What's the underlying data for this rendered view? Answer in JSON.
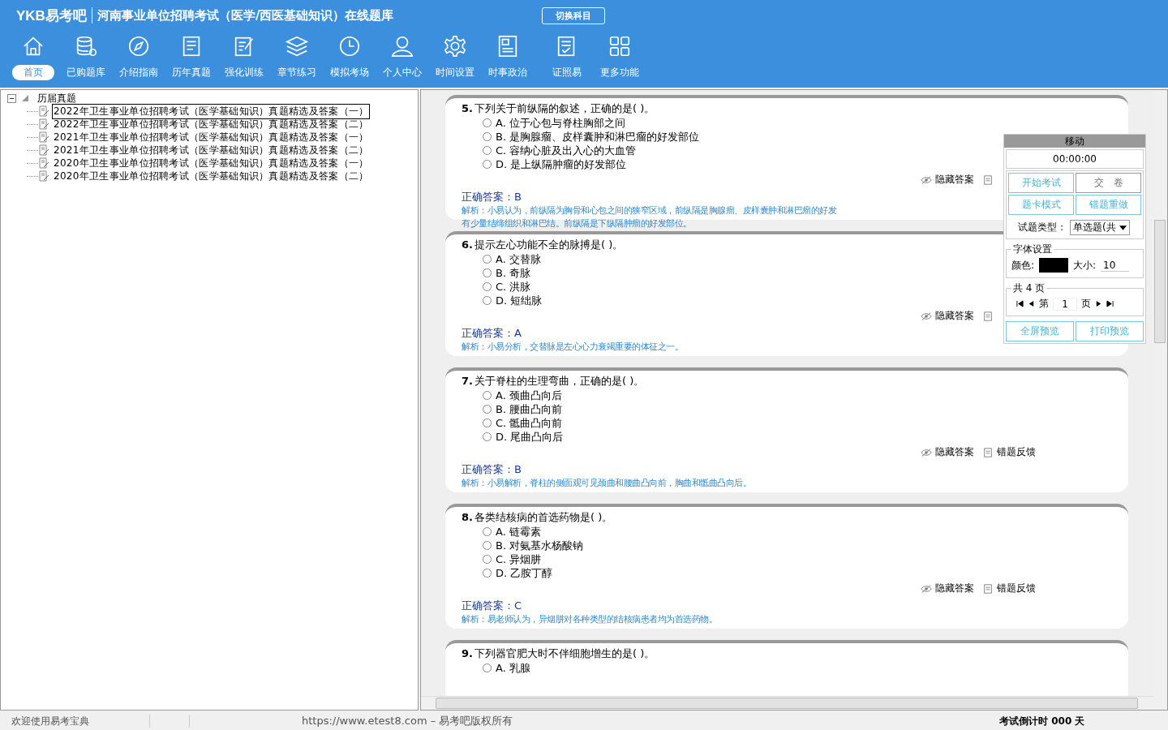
{
  "header": {
    "logo": "YKB易考吧",
    "title": "河南事业单位招聘考试（医学/西医基础知识）在线题库",
    "switch_button": "切换科目"
  },
  "nav": [
    {
      "label": "首页",
      "selected": true
    },
    {
      "label": "已购题库",
      "selected": false
    },
    {
      "label": "介绍指南",
      "selected": false
    },
    {
      "label": "历年真题",
      "selected": false
    },
    {
      "label": "强化训练",
      "selected": false
    },
    {
      "label": "章节练习",
      "selected": false
    },
    {
      "label": "模拟考场",
      "selected": false
    },
    {
      "label": "个人中心",
      "selected": false
    },
    {
      "label": "时间设置",
      "selected": false
    },
    {
      "label": "时事政治",
      "selected": false
    },
    {
      "label": "证照易",
      "selected": false
    },
    {
      "label": "更多功能",
      "selected": false
    }
  ],
  "tree": {
    "label": "历届真题",
    "expanded": true,
    "children": [
      {
        "label": "2022年卫生事业单位招聘考试（医学基础知识）真题精选及答案（一）",
        "selected": true
      },
      {
        "label": "2022年卫生事业单位招聘考试（医学基础知识）真题精选及答案（二）",
        "selected": false
      },
      {
        "label": "2021年卫生事业单位招聘考试（医学基础知识）真题精选及答案（一）",
        "selected": false
      },
      {
        "label": "2021年卫生事业单位招聘考试（医学基础知识）真题精选及答案（二）",
        "selected": false
      },
      {
        "label": "2020年卫生事业单位招聘考试（医学基础知识）真题精选及答案（一）",
        "selected": false
      },
      {
        "label": "2020年卫生事业单位招聘考试（医学基础知识）真题精选及答案（二）",
        "selected": false
      }
    ]
  },
  "questions": [
    {
      "number": "5.",
      "title": "下列关于前纵隔的叙述，正确的是( )。",
      "options": [
        {
          "letter": "A.",
          "text": "位于心包与脊柱胸部之间",
          "selected": false
        },
        {
          "letter": "B.",
          "text": "是胸腺瘤、皮样囊肿和淋巴瘤的好发部位",
          "selected": false
        },
        {
          "letter": "C.",
          "text": "容纳心脏及出入心的大血管",
          "selected": false
        },
        {
          "letter": "D.",
          "text": "是上纵隔肿瘤的好发部位",
          "selected": false
        }
      ],
      "hide_answer": "隐藏答案",
      "answer_label": "正确答案：",
      "answer": "B",
      "analysis": [
        "解析：小易认为，前纵隔为胸骨和心包之间的狭窄区域，前纵隔是胸腺瘤、皮样囊肿和淋巴瘤的好发",
        "有少量结缔组织和淋巴结。前纵隔是下纵隔肿瘤的好发部位。"
      ]
    },
    {
      "number": "6.",
      "title": "提示左心功能不全的脉搏是( )。",
      "options": [
        {
          "letter": "A.",
          "text": "交替脉",
          "selected": false
        },
        {
          "letter": "B.",
          "text": "奇脉",
          "selected": false
        },
        {
          "letter": "C.",
          "text": "洪脉",
          "selected": false
        },
        {
          "letter": "D.",
          "text": "短绌脉",
          "selected": false
        }
      ],
      "hide_answer": "隐藏答案",
      "answer_label": "正确答案：",
      "answer": "A",
      "analysis": [
        "解析：小易分析，交替脉是左心心力衰竭重要的体征之一。"
      ]
    },
    {
      "number": "7.",
      "title": "关于脊柱的生理弯曲，正确的是( )。",
      "options": [
        {
          "letter": "A.",
          "text": "颈曲凸向后",
          "selected": false
        },
        {
          "letter": "B.",
          "text": "腰曲凸向前",
          "selected": false
        },
        {
          "letter": "C.",
          "text": "骶曲凸向前",
          "selected": false
        },
        {
          "letter": "D.",
          "text": "尾曲凸向后",
          "selected": false
        }
      ],
      "hide_answer": "隐藏答案",
      "feedback": "错题反馈",
      "answer_label": "正确答案：",
      "answer": "B",
      "analysis": [
        "解析：小易解析，脊柱的侧面观可见颈曲和腰曲凸向前，胸曲和骶曲凸向后。"
      ]
    },
    {
      "number": "8.",
      "title": "各类结核病的首选药物是( )。",
      "options": [
        {
          "letter": "A.",
          "text": "链霉素",
          "selected": false
        },
        {
          "letter": "B.",
          "text": "对氨基水杨酸钠",
          "selected": false
        },
        {
          "letter": "C.",
          "text": "异烟肼",
          "selected": false
        },
        {
          "letter": "D.",
          "text": "乙胺丁醇",
          "selected": false
        }
      ],
      "hide_answer": "隐藏答案",
      "feedback": "错题反馈",
      "answer_label": "正确答案：",
      "answer": "C",
      "analysis": [
        "解析：易老师认为，异烟肼对各种类型的结核病患者均为首选药物。"
      ]
    },
    {
      "number": "9.",
      "title": "下列器官肥大时不伴细胞增生的是( )。",
      "options": [
        {
          "letter": "A.",
          "text": "乳腺",
          "selected": false
        }
      ]
    }
  ],
  "panel": {
    "title": "移动",
    "timer": "00:00:00",
    "buttons": [
      "开始考试",
      "交　卷",
      "题卡模式",
      "错题重做"
    ],
    "type_label": "试题类型：",
    "type_value": "单选题(共",
    "font_legend": "字体设置",
    "color_label": "颜色:",
    "color": "#000000",
    "size_label": "大小:",
    "size_value": "10",
    "pages_legend": "共 4 页",
    "page_prefix": "第",
    "page_value": "1",
    "page_suffix": "页",
    "bottom_buttons": [
      "全屏预览",
      "打印预览"
    ]
  },
  "status_bar": {
    "welcome": "欢迎使用易考宝典",
    "copyright": "https://www.etest8.com – 易考吧版权所有",
    "countdown": "考试倒计时 000 天"
  }
}
